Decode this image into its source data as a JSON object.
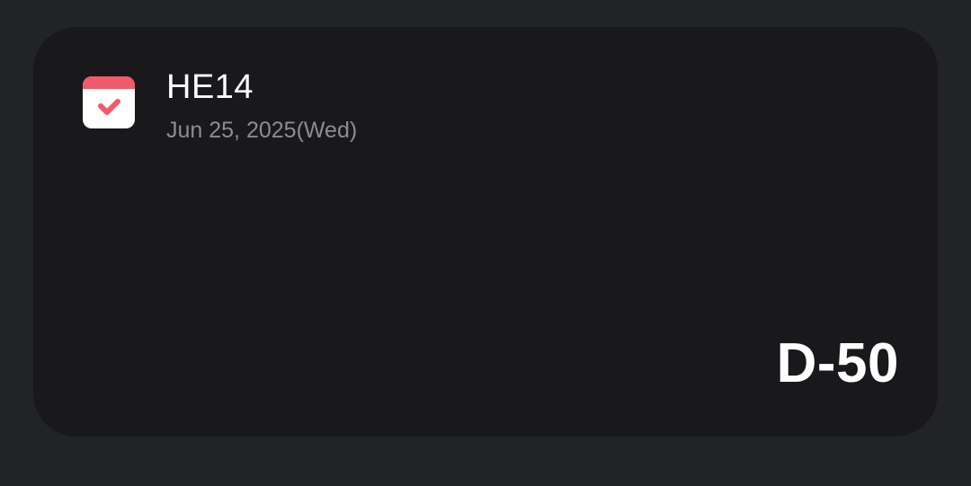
{
  "widget": {
    "icon": "calendar-check-icon",
    "title": "HE14",
    "date": "Jun 25, 2025(Wed)",
    "dday": "D-50"
  },
  "colors": {
    "background": "#212327",
    "card": "#19191c",
    "icon_accent": "#f05a6a",
    "title_text": "#ffffff",
    "date_text": "#8a8d93"
  }
}
